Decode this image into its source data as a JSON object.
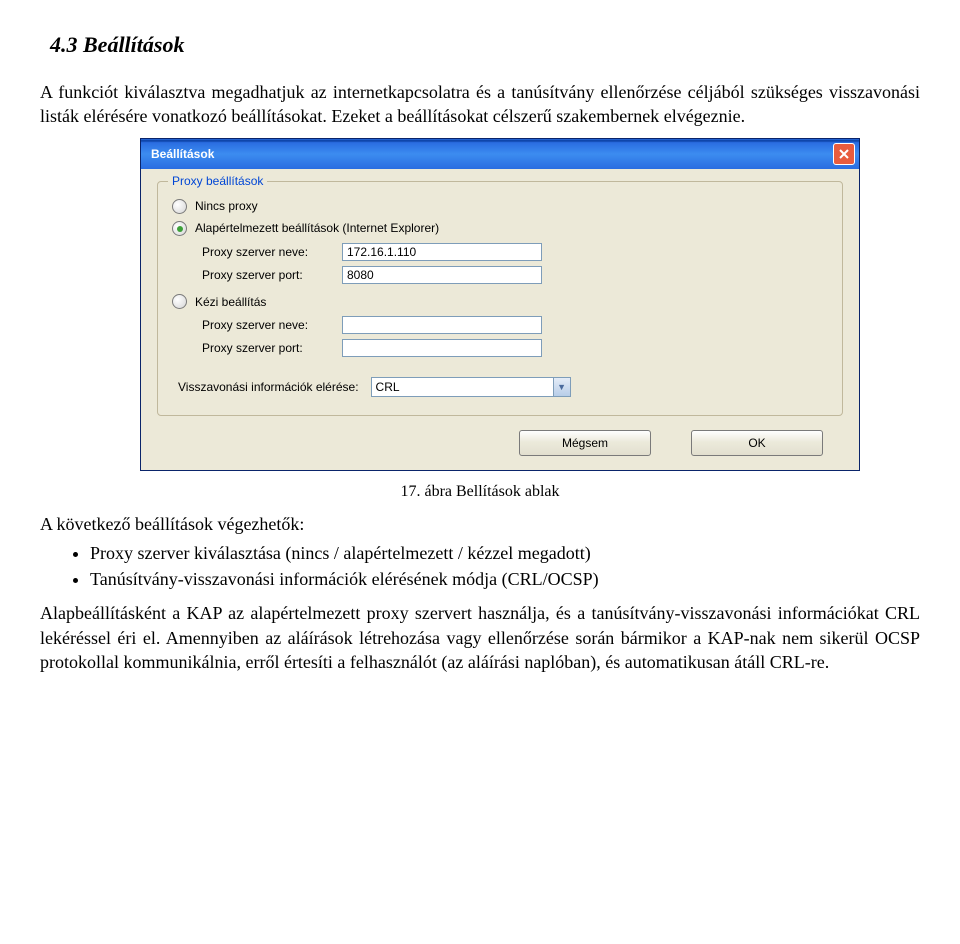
{
  "doc": {
    "heading": "4.3  Beállítások",
    "para1": "A funkciót kiválasztva megadhatjuk az internetkapcsolatra és a tanúsítvány ellenőrzése céljából szükséges visszavonási listák elérésére vonatkozó beállításokat. Ezeket a beállításokat célszerű szakembernek elvégeznie.",
    "caption": "17. ábra Bellítások ablak",
    "para2_intro": "A következő beállítások végezhetők:",
    "bullet1": "Proxy szerver kiválasztása (nincs / alapértelmezett / kézzel megadott)",
    "bullet2": "Tanúsítvány-visszavonási információk elérésének módja (CRL/OCSP)",
    "para3": "Alapbeállításként a KAP az alapértelmezett proxy szervert használja, és a tanúsítvány-visszavonási információkat CRL lekéréssel éri el. Amennyiben az aláírások létrehozása vagy ellenőrzése során bármikor a KAP-nak nem sikerül OCSP protokollal kommunikálnia, erről értesíti a felhasználót (az aláírási naplóban), és automatikusan átáll CRL-re."
  },
  "dialog": {
    "title": "Beállítások",
    "group_legend": "Proxy beállítások",
    "radio_none": "Nincs proxy",
    "radio_default": "Alapértelmezett beállítások (Internet Explorer)",
    "label_server_name": "Proxy szerver neve:",
    "label_server_port": "Proxy szerver port:",
    "value_server_name": "172.16.1.110",
    "value_server_port": "8080",
    "radio_manual": "Kézi beállítás",
    "value_server_name2": "",
    "value_server_port2": "",
    "vissza_label": "Visszavonási információk elérése:",
    "vissza_value": "CRL",
    "btn_cancel": "Mégsem",
    "btn_ok": "OK"
  }
}
